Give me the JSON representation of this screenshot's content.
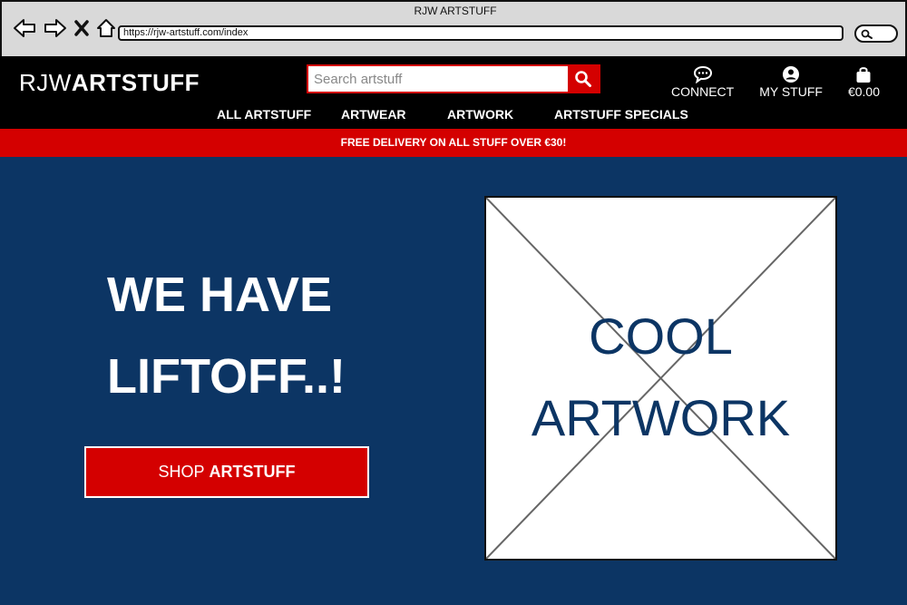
{
  "browser": {
    "window_title": "RJW ARTSTUFF",
    "url": "https://rjw-artstuff.com/index",
    "icons": [
      "back-arrow-icon",
      "forward-arrow-icon",
      "close-icon",
      "home-icon",
      "search-icon"
    ]
  },
  "header": {
    "logo_part1": "RJW",
    "logo_part2": "ARTSTUFF",
    "search_placeholder": "Search artstuff",
    "actions": [
      {
        "label": "CONNECT",
        "icon": "chat-icon"
      },
      {
        "label": "MY STUFF",
        "icon": "user-icon"
      },
      {
        "label": "€0.00",
        "icon": "shopping-bag-icon"
      }
    ]
  },
  "nav": {
    "items": [
      "ALL ARTSTUFF",
      "ARTWEAR",
      "ARTWORK",
      "ARTSTUFF SPECIALS"
    ]
  },
  "banner": {
    "text": "FREE DELIVERY ON ALL STUFF OVER €30!"
  },
  "hero": {
    "line1": "WE HAVE",
    "line2": "LIFTOFF..!",
    "button_part1": "SHOP",
    "button_part2": "ARTSTUFF",
    "image_line1": "COOL",
    "image_line2": "ARTWORK"
  },
  "colors": {
    "brand_red": "#d40000",
    "hero_blue": "#0c3564",
    "header_black": "#000000"
  }
}
